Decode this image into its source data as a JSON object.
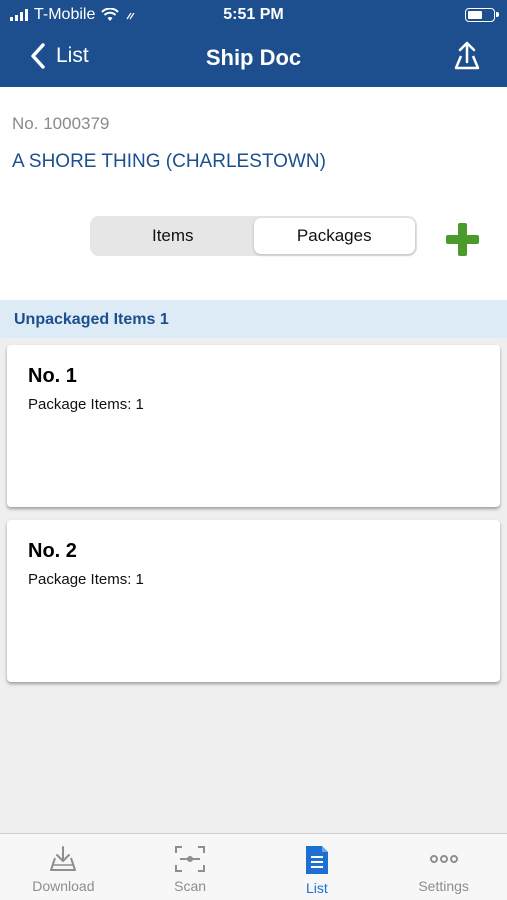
{
  "status_bar": {
    "carrier": "T-Mobile",
    "time": "5:51 PM"
  },
  "nav": {
    "back_label": "List",
    "title": "Ship Doc"
  },
  "document": {
    "number_label": "No.",
    "number": "1000379",
    "customer": "A SHORE THING (CHARLESTOWN)"
  },
  "segmented_control": {
    "options": [
      "Items",
      "Packages"
    ],
    "selected": "Packages"
  },
  "section": {
    "label": "Unpackaged Items 1"
  },
  "packages": [
    {
      "title": "No. 1",
      "items_text": "Package Items: 1"
    },
    {
      "title": "No. 2",
      "items_text": "Package Items: 1"
    }
  ],
  "tab_bar": {
    "tabs": [
      {
        "label": "Download",
        "icon": "download-icon"
      },
      {
        "label": "Scan",
        "icon": "scan-icon"
      },
      {
        "label": "List",
        "icon": "list-document-icon"
      },
      {
        "label": "Settings",
        "icon": "ellipsis-icon"
      }
    ],
    "active": "List"
  },
  "colors": {
    "header": "#1d4f8e",
    "add_button": "#4a9a2c",
    "section_bg": "#dcebf5",
    "active_tab": "#1d6fd1"
  }
}
